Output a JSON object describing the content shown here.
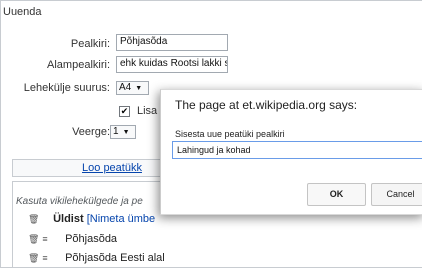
{
  "form": {
    "legend": "Uuenda",
    "title_label": "Pealkiri:",
    "title_value": "Põhjasõda",
    "subtitle_label": "Alampealkiri:",
    "subtitle_value": "ehk kuidas Rootsi lakki sa",
    "pagesize_label": "Lehekülje suurus:",
    "pagesize_value": "A4",
    "checkbox_label": "Lisa si",
    "checkbox_mark": "✔",
    "columns_label": "Veerge:",
    "columns_value": "1",
    "new_chapter_link": "Loo peatükk"
  },
  "outline": {
    "hint": "Kasuta vikilehekülgede ja pe",
    "rows": [
      {
        "bold": "Üldist",
        "link": "[Nimeta ümbe"
      },
      {
        "text": "Põhjasõda"
      },
      {
        "text": "Põhjasõda Eesti alal"
      }
    ]
  },
  "dialog": {
    "title": "The page at et.wikipedia.org says:",
    "message": "Sisesta uue peatüki pealkiri",
    "input_value": "Lahingud ja kohad",
    "ok_label": "OK",
    "cancel_label": "Cancel"
  },
  "colors": {
    "link": "#0645ad",
    "input_focus": "#6a9ce8",
    "border": "#c8ccd1"
  }
}
